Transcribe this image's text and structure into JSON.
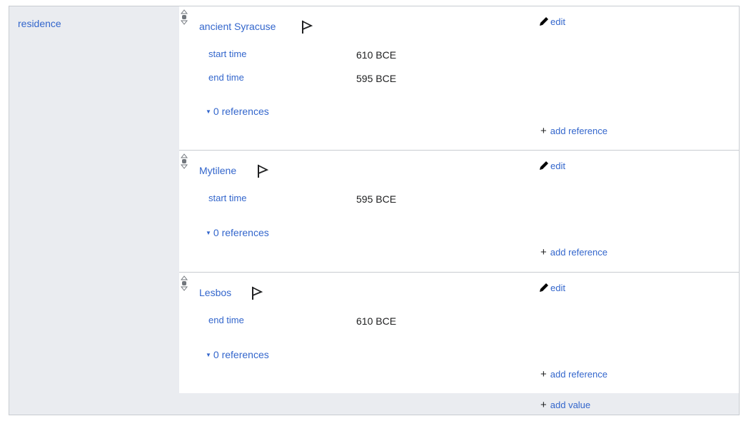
{
  "property": {
    "label": "residence"
  },
  "statements": [
    {
      "value": "ancient Syracuse",
      "edit_label": "edit",
      "qualifiers": [
        {
          "property": "start time",
          "value": "610 BCE"
        },
        {
          "property": "end time",
          "value": "595 BCE"
        }
      ],
      "references_label": "0 references",
      "add_reference_label": "add reference"
    },
    {
      "value": "Mytilene",
      "edit_label": "edit",
      "qualifiers": [
        {
          "property": "start time",
          "value": "595 BCE"
        }
      ],
      "references_label": "0 references",
      "add_reference_label": "add reference"
    },
    {
      "value": "Lesbos",
      "edit_label": "edit",
      "qualifiers": [
        {
          "property": "end time",
          "value": "610 BCE"
        }
      ],
      "references_label": "0 references",
      "add_reference_label": "add reference"
    }
  ],
  "add_value_label": "add value",
  "colors": {
    "link": "#3366cc",
    "border": "#c8ccd1",
    "panel": "#eaecf0",
    "text": "#202122"
  }
}
